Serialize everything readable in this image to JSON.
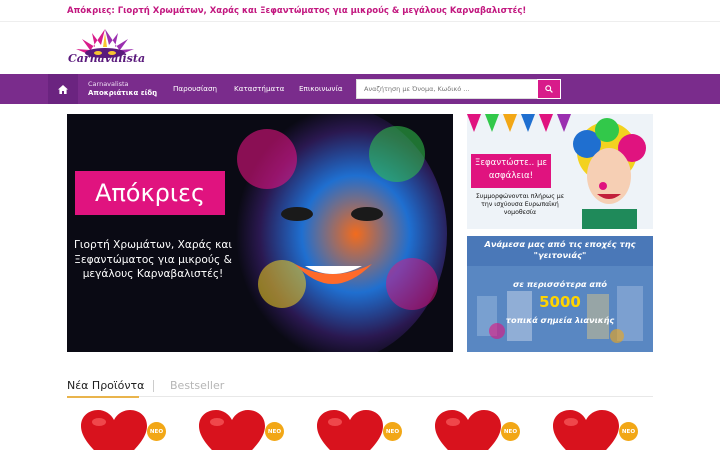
{
  "topbar": {
    "message": "Απόκριες: Γιορτή Χρωμάτων, Χαράς και Ξεφαντώματος για μικρούς & μεγάλους Καρναβαλιστές!"
  },
  "logo": {
    "text": "Carnavalista"
  },
  "nav": {
    "home_icon": "home-icon",
    "category_small": "Carnavalista",
    "category_label": "Αποκριάτικα είδη",
    "links": [
      "Παρουσίαση",
      "Καταστήματα",
      "Επικοινωνία"
    ]
  },
  "search": {
    "placeholder": "Αναζήτηση με Όνομα, Κωδικό ...",
    "icon": "search-icon"
  },
  "hero": {
    "title": "Απόκριες",
    "subtitle": "Γιορτή Χρωμάτων, Χαράς και Ξεφαντώματος για μικρούς & μεγάλους Καρναβαλιστές!"
  },
  "banner1": {
    "tag": "Ξεφαντώστε.. με ασφάλεια!",
    "text": "Συμμορφώνονται πλήρως με την ισχύουσα Ευρωπαϊκή νομοθεσία"
  },
  "banner2": {
    "line1": "Ανάμεσα μας από τις εποχές της \"γειτονιάς\"",
    "line2": "σε περισσότερα από",
    "number": "5000",
    "line3": "τοπικά σημεία λιανικής"
  },
  "tabs": {
    "active": "Νέα Προϊόντα",
    "inactive": "Bestseller"
  },
  "products": [
    {
      "badge": "ΝΕΟ"
    },
    {
      "badge": "ΝΕΟ"
    },
    {
      "badge": "ΝΕΟ"
    },
    {
      "badge": "ΝΕΟ"
    },
    {
      "badge": "ΝΕΟ"
    }
  ],
  "colors": {
    "brand_purple": "#7a2c8c",
    "accent_pink": "#d81b8a",
    "badge_orange": "#f2a716",
    "tab_underline": "#e9b44c"
  }
}
